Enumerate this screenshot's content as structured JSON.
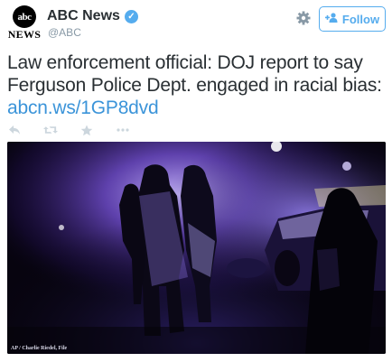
{
  "user": {
    "avatar_text": "abc",
    "avatar_word": "NEWS",
    "display_name": "ABC News",
    "handle": "@ABC",
    "verified_mark": "✓"
  },
  "header": {
    "follow_label": "Follow",
    "gear_icon": "gear-icon",
    "follow_icon": "add-user-icon"
  },
  "tweet": {
    "text": "Law enforcement official: DOJ report to say Ferguson Police Dept. engaged in racial bias:",
    "link": "abcn.ws/1GP8dvd"
  },
  "actions": {
    "icons": [
      "reply-icon",
      "retweet-icon",
      "favorite-icon",
      "more-icon"
    ]
  },
  "photo": {
    "credit": "AP / Charlie Riedel, File"
  },
  "colors": {
    "accent": "#55acee",
    "link": "#3b94d9",
    "text": "#292f33",
    "muted": "#8899a6"
  }
}
